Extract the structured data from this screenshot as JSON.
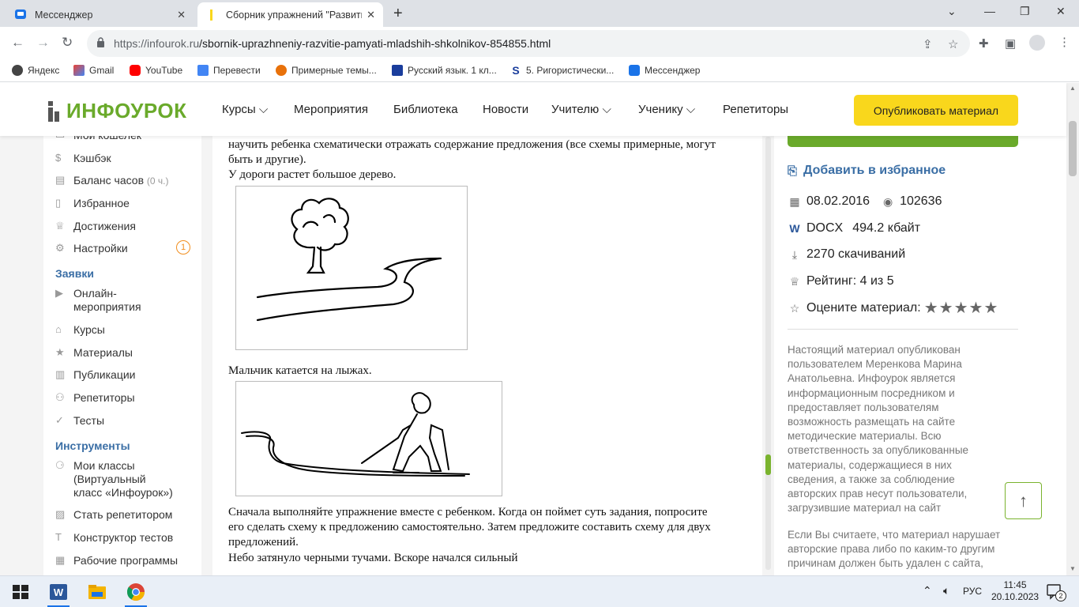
{
  "browser": {
    "tabs": [
      {
        "title": "Мессенджер",
        "active": false
      },
      {
        "title": "Сборник упражнений \"Развитие",
        "active": true
      }
    ],
    "url": {
      "domain": "https://infourok.ru",
      "path": "/sbornik-uprazhneniy-razvitie-pamyati-mladshih-shkolnikov-854855.html"
    },
    "bookmarks": [
      "Яндекс",
      "Gmail",
      "YouTube",
      "Перевести",
      "Примерные темы...",
      "Русский язык. 1 кл...",
      "5. Ригористически...",
      "Мессенджер"
    ]
  },
  "site": {
    "logo": "ИНФОУРОК",
    "menu": [
      "Курсы",
      "Мероприятия",
      "Библиотека",
      "Новости",
      "Учителю",
      "Ученику",
      "Репетиторы"
    ],
    "publish_label": "Опубликовать материал"
  },
  "sidebar": {
    "items_top": [
      {
        "label": "Мой кошелек",
        "icon": "wallet-icon"
      },
      {
        "label": "Кэшбэк",
        "icon": "cashback-icon"
      },
      {
        "label": "Баланс часов",
        "suffix": "(0 ч.)",
        "icon": "hours-icon"
      },
      {
        "label": "Избранное",
        "icon": "bookmark-icon"
      },
      {
        "label": "Достижения",
        "icon": "trophy-icon"
      },
      {
        "label": "Настройки",
        "icon": "gear-icon",
        "badge": "1"
      }
    ],
    "section_requests": "Заявки",
    "items_requests": [
      {
        "label": "Онлайн-",
        "label2": "мероприятия",
        "icon": "video-icon"
      },
      {
        "label": "Курсы",
        "icon": "hat-icon"
      },
      {
        "label": "Материалы",
        "icon": "star-icon"
      },
      {
        "label": "Публикации",
        "icon": "book-icon"
      },
      {
        "label": "Репетиторы",
        "icon": "people-icon"
      },
      {
        "label": "Тесты",
        "icon": "check-icon"
      }
    ],
    "section_tools": "Инструменты",
    "items_tools": [
      {
        "label": "Мои классы",
        "label2": "(Виртуальный",
        "label3": "класс «Инфоурок»)",
        "icon": "class-icon"
      },
      {
        "label": "Стать репетитором",
        "icon": "tutor-icon"
      },
      {
        "label": "Конструктор тестов",
        "icon": "text-icon"
      },
      {
        "label": "Рабочие программы",
        "icon": "calendar-icon"
      }
    ]
  },
  "document": {
    "line1": "научить ребенка схематически отражать содержание предложения (все схемы примерные, могут",
    "line2": "быть и другие).",
    "line3": "У дороги растет большое дерево.",
    "line4": "Мальчик катается на лыжах.",
    "line5": "Сначала выполняйте упражнение вместе с ребенком. Когда он поймет суть задания, попросите",
    "line6": "его сделать схему к предложению самостоятельно. Затем предложите составить схему для двух",
    "line7": "предложений.",
    "line8": "Небо затянуло черными тучами. Вскоре начался сильный"
  },
  "info": {
    "favorite": "Добавить в избранное",
    "date": "08.02.2016",
    "views": "102636",
    "format": "DOCX",
    "size": "494.2 кбайт",
    "downloads": "2270 скачиваний",
    "rating": "Рейтинг: 4 из 5",
    "rate_label": "Оцените материал:",
    "rate_max": 5,
    "disclaimer": [
      "Настоящий материал опубликован",
      "пользователем Меренкова Марина",
      "Анатольевна. Инфоурок является",
      "информационным посредником и",
      "предоставляет пользователям",
      "возможность размещать на сайте",
      "методические материалы. Всю",
      "ответственность за опубликованные",
      "материалы, содержащиеся в них",
      "сведения, а также за соблюдение",
      "авторских прав несут пользователи,",
      "загрузившие материал на сайт"
    ],
    "disclaimer2": [
      "Если Вы считаете, что материал нарушает",
      "авторские права либо по каким-то другим",
      "причинам должен быть удален с сайта,"
    ]
  },
  "taskbar": {
    "lang": "РУС",
    "time": "11:45",
    "date": "20.10.2023",
    "notifications": "2"
  },
  "colors": {
    "green": "#6aaa2b",
    "yellow": "#f9d71c",
    "blue": "#3a6ea5",
    "orange": "#f18e1e"
  }
}
